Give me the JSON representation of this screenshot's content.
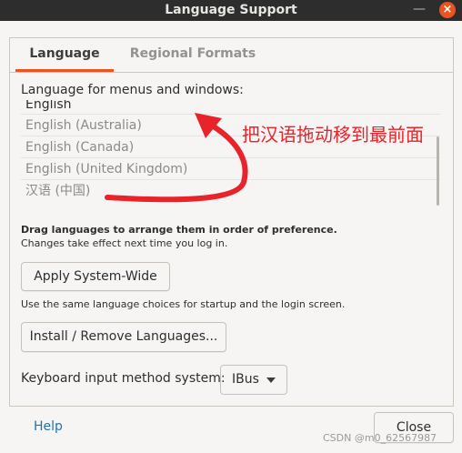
{
  "window": {
    "title": "Language Support",
    "minimize_glyph": "—",
    "close_glyph": "×"
  },
  "tabs": [
    {
      "label": "Language",
      "active": true
    },
    {
      "label": "Regional Formats",
      "active": false
    }
  ],
  "language_section": {
    "label": "Language for menus and windows:",
    "languages": [
      "English",
      "English (Australia)",
      "English (Canada)",
      "English (United Kingdom)",
      "汉语 (中国)"
    ]
  },
  "hints": {
    "drag": "Drag languages to arrange them in order of preference.",
    "changes": "Changes take effect next time you log in."
  },
  "apply_button": "Apply System-Wide",
  "startup_note": "Use the same language choices for startup and the login screen.",
  "install_button": "Install / Remove Languages...",
  "keyboard": {
    "label": "Keyboard input method system:",
    "value": "IBus"
  },
  "footer": {
    "help": "Help",
    "close": "Close"
  },
  "annotation": {
    "text": "把汉语拖动移到最前面",
    "color": "#e8232a"
  },
  "watermark": "CSDN @m0_62567987",
  "colors": {
    "accent": "#e95420",
    "link": "#1a73b8",
    "annotation": "#e8232a"
  }
}
